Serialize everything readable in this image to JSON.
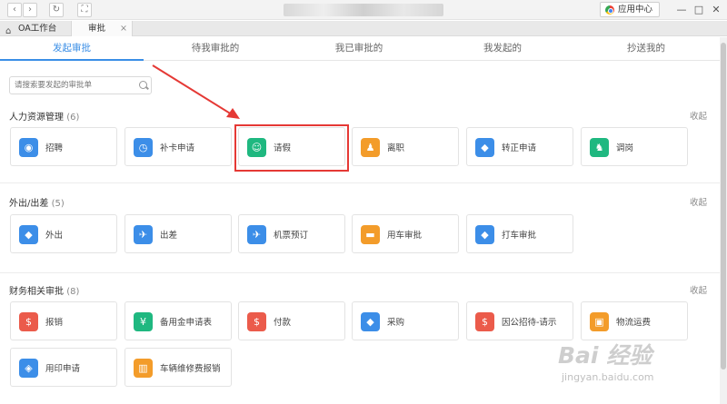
{
  "window": {
    "app_center_label": "应用中心",
    "minimize_glyph": "—",
    "maximize_glyph": "□",
    "close_glyph": "✕",
    "back_glyph": "‹",
    "forward_glyph": "›",
    "refresh_glyph": "↻",
    "expand_glyph": "⛶"
  },
  "tabs": [
    {
      "label": "OA工作台"
    },
    {
      "label": "审批",
      "close": "×"
    }
  ],
  "main_tabs": [
    {
      "label": "发起审批",
      "active": true
    },
    {
      "label": "待我审批的"
    },
    {
      "label": "我已审批的"
    },
    {
      "label": "我发起的"
    },
    {
      "label": "抄送我的"
    }
  ],
  "search": {
    "placeholder": "请搜索要发起的审批单"
  },
  "collapse_label": "收起",
  "sections": [
    {
      "title": "人力资源管理",
      "count": "(6)",
      "items": [
        {
          "label": "招聘",
          "icon": "recruit-icon",
          "color": "#3c8ee8"
        },
        {
          "label": "补卡申请",
          "icon": "clock-icon",
          "color": "#3c8ee8"
        },
        {
          "label": "请假",
          "icon": "person-icon",
          "color": "#1fb880"
        },
        {
          "label": "离职",
          "icon": "resign-icon",
          "color": "#f39c2a"
        },
        {
          "label": "转正申请",
          "icon": "ticket-icon",
          "color": "#3c8ee8"
        },
        {
          "label": "调岗",
          "icon": "transfer-icon",
          "color": "#1fb880"
        }
      ]
    },
    {
      "title": "外出/出差",
      "count": "(5)",
      "items": [
        {
          "label": "外出",
          "icon": "ticket-icon",
          "color": "#3c8ee8"
        },
        {
          "label": "出差",
          "icon": "plane-icon",
          "color": "#3c8ee8"
        },
        {
          "label": "机票预订",
          "icon": "plane-icon",
          "color": "#3c8ee8"
        },
        {
          "label": "用车审批",
          "icon": "car-icon",
          "color": "#f39c2a"
        },
        {
          "label": "打车审批",
          "icon": "ticket-icon",
          "color": "#3c8ee8"
        }
      ]
    },
    {
      "title": "财务相关审批",
      "count": "(8)",
      "items": [
        {
          "label": "报销",
          "icon": "money-bag-icon",
          "color": "#eb5b4b"
        },
        {
          "label": "备用金申请表",
          "icon": "dollar-hand-icon",
          "color": "#1fb880"
        },
        {
          "label": "付款",
          "icon": "money-bag-icon",
          "color": "#eb5b4b"
        },
        {
          "label": "采购",
          "icon": "ticket-icon",
          "color": "#3c8ee8"
        },
        {
          "label": "因公招待-请示",
          "icon": "money-bag-icon",
          "color": "#eb5b4b"
        },
        {
          "label": "物流运费",
          "icon": "cart-icon",
          "color": "#f39c2a"
        },
        {
          "label": "用印申请",
          "icon": "shield-icon",
          "color": "#3c8ee8"
        },
        {
          "label": "车辆维修费报销",
          "icon": "chart-icon",
          "color": "#f39c2a"
        }
      ]
    }
  ],
  "icon_glyphs": {
    "recruit-icon": "◉",
    "clock-icon": "◷",
    "person-icon": "☺",
    "resign-icon": "♟",
    "ticket-icon": "◆",
    "transfer-icon": "♞",
    "plane-icon": "✈",
    "car-icon": "▬",
    "money-bag-icon": "$",
    "dollar-hand-icon": "¥",
    "cart-icon": "▣",
    "shield-icon": "◈",
    "chart-icon": "▥"
  },
  "watermark": {
    "brand": "Bai 经验",
    "url": "jingyan.baidu.com"
  },
  "annotation_color": "#e53935"
}
